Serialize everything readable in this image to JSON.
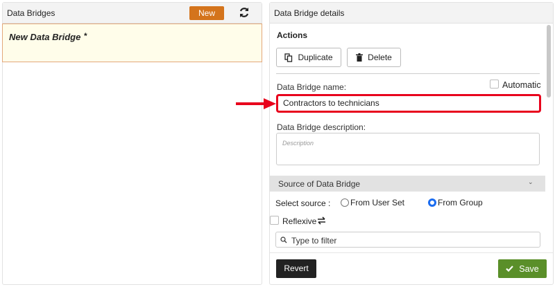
{
  "left": {
    "title": "Data Bridges",
    "new_label": "New",
    "refresh_icon": "refresh-icon",
    "items": [
      {
        "label": "New Data Bridge",
        "modified": "*"
      }
    ]
  },
  "right": {
    "title": "Data Bridge details",
    "actions_label": "Actions",
    "duplicate_label": "Duplicate",
    "delete_label": "Delete",
    "name_label": "Data Bridge name:",
    "automatic_label": "Automatic",
    "name_value": "Contractors to technicians",
    "description_label": "Data Bridge description:",
    "description_placeholder": "Description",
    "source_section": "Source of Data Bridge",
    "select_source_label": "Select source :",
    "source_options": [
      "From User Set",
      "From Group"
    ],
    "selected_source": "From Group",
    "reflexive_label": "Reflexive",
    "filter_placeholder": "Type to filter",
    "revert_label": "Revert",
    "save_label": "Save"
  },
  "colors": {
    "new_button": "#d4741c",
    "save_button": "#5a8f29",
    "highlight": "#e8001c",
    "selected_item_bg": "#fffdea"
  }
}
